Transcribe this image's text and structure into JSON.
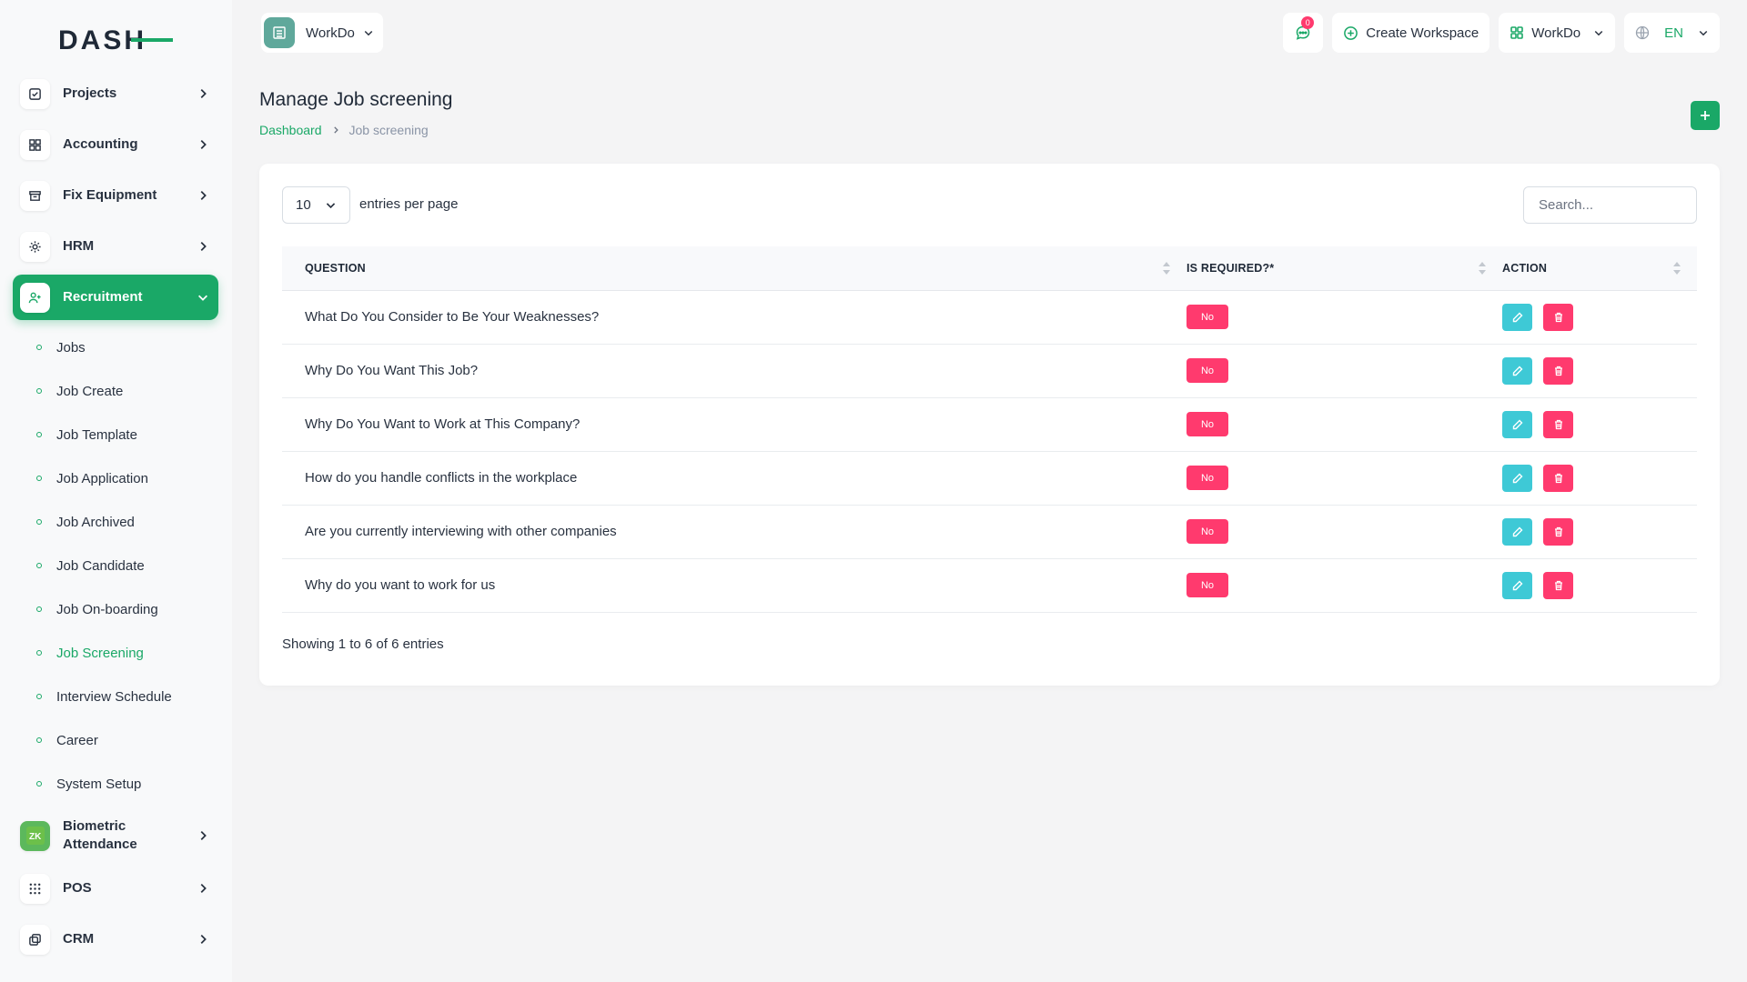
{
  "brand": {
    "logo_text": "DASH",
    "accent": "#1aa867"
  },
  "sidebar": {
    "items": [
      {
        "label": "Projects",
        "icon": "checkbox-icon"
      },
      {
        "label": "Accounting",
        "icon": "grid-icon"
      },
      {
        "label": "Fix Equipment",
        "icon": "archive-icon"
      },
      {
        "label": "HRM",
        "icon": "settings-icon"
      },
      {
        "label": "Recruitment",
        "icon": "user-plus-icon"
      }
    ],
    "recruitment_sub": [
      "Jobs",
      "Job Create",
      "Job Template",
      "Job Application",
      "Job Archived",
      "Job Candidate",
      "Job On-boarding",
      "Job Screening",
      "Interview Schedule",
      "Career",
      "System Setup"
    ],
    "after_items": [
      {
        "label": "Biometric Attendance",
        "icon": "zk-icon"
      },
      {
        "label": "POS",
        "icon": "dots-grid-icon"
      },
      {
        "label": "CRM",
        "icon": "layers-icon"
      }
    ]
  },
  "topbar": {
    "workspace_name": "WorkDo",
    "notification_count": "0",
    "create_workspace_label": "Create Workspace",
    "workspace_menu_label": "WorkDo",
    "language": "EN"
  },
  "page": {
    "title": "Manage Job screening",
    "breadcrumb": {
      "home": "Dashboard",
      "current": "Job screening"
    }
  },
  "table_controls": {
    "per_page_value": "10",
    "per_page_label": "entries per page",
    "search_placeholder": "Search..."
  },
  "table": {
    "headers": {
      "question": "QUESTION",
      "required": "IS REQUIRED?*",
      "action": "ACTION"
    },
    "rows": [
      {
        "question": "What Do You Consider to Be Your Weaknesses?",
        "required": "No"
      },
      {
        "question": "Why Do You Want This Job?",
        "required": "No"
      },
      {
        "question": "Why Do You Want to Work at This Company?",
        "required": "No"
      },
      {
        "question": "How do you handle conflicts in the workplace",
        "required": "No"
      },
      {
        "question": "Are you currently interviewing with other companies",
        "required": "No"
      },
      {
        "question": "Why do you want to work for us",
        "required": "No"
      }
    ],
    "footer": "Showing 1 to 6 of 6 entries"
  }
}
